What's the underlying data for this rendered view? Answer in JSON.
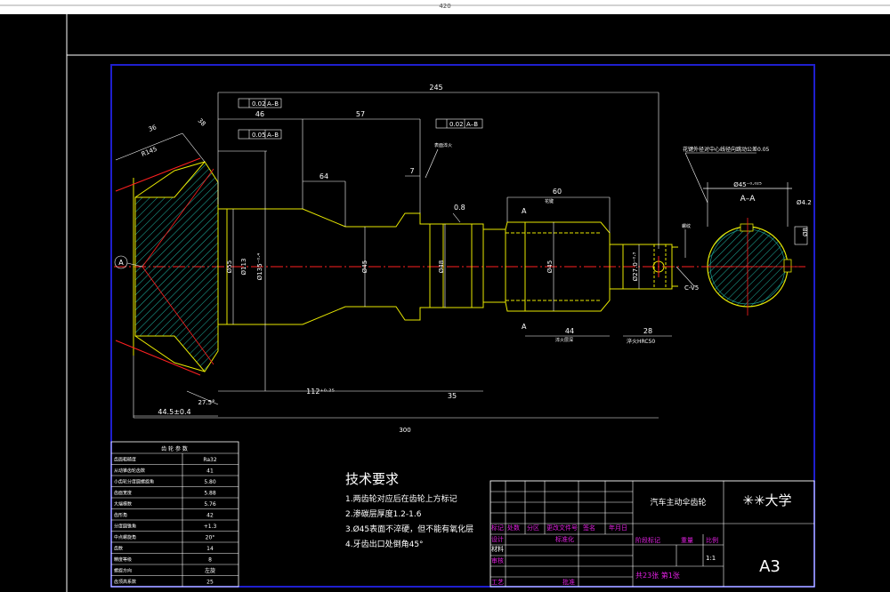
{
  "sheet": {
    "overall_width_label": "420",
    "format_label": "A3",
    "university_label": "✳✳大学",
    "part_name": "汽车主动伞齿轮",
    "scale_value": "1:1",
    "sheet_count": "共23张 第1张"
  },
  "dimensions": {
    "d245": "245",
    "d46": "46",
    "d57": "57",
    "d64": "64",
    "d7": "7",
    "d60": "60",
    "d44": "44",
    "d28": "28",
    "d35": "35",
    "d300": "300",
    "d112": "112⁺⁰·²⁵",
    "d44_5": "44.5±0.4",
    "d27_5": "27.5°",
    "d38": "38",
    "d36": "36",
    "r145": "R145",
    "phi45_shaft": "Ø45",
    "phi48": "Ø48",
    "phi45_spline": "Ø45",
    "phi27": "Ø27.0⁻⁰·³",
    "phi113": "Ø113",
    "phi135": "Ø135⁻⁰·⁴",
    "phi55": "Ø55",
    "phi45_section": "Ø45⁻⁰·⁰²⁵",
    "phi42": "Ø4.2",
    "phi8": "Ø8",
    "rough_08": "0.8",
    "c_v5": "C-V5",
    "hrc": "淬火HRC50",
    "section_label": "A–A",
    "datum_a": "A",
    "tol1": "0.02",
    "tol1_ref": "A–B",
    "tol2": "0.05",
    "tol2_ref": "A–B",
    "tol3": "0.02",
    "tol3_ref": "A–B",
    "tol4": "0.05",
    "note_spline": "花键外径对中心线径向跳动公差0.05",
    "note_small1": "表面淬火",
    "note_small2": "花键",
    "note_small3": "淬火层深",
    "note_small4": "渗碳淬火",
    "note_small5": "螺纹",
    "cut_a1": "A",
    "cut_a2": "A"
  },
  "gear_params": {
    "title": "齿 轮 参 数",
    "rows": [
      {
        "name": "齿面粗糙度",
        "value": "Ra32"
      },
      {
        "name": "从动锥齿轮齿数",
        "value": "41"
      },
      {
        "name": "小齿轮分度圆螺旋角",
        "value": "5.80"
      },
      {
        "name": "齿面宽度",
        "value": "5.88"
      },
      {
        "name": "大端模数",
        "value": "5.76"
      },
      {
        "name": "齿形角",
        "value": "42"
      },
      {
        "name": "分度圆锥角",
        "value": "+1.3"
      },
      {
        "name": "中点螺旋角",
        "value": "20°"
      },
      {
        "name": "齿数",
        "value": "14"
      },
      {
        "name": "精度等级",
        "value": "8"
      },
      {
        "name": "螺旋方向",
        "value": "左旋"
      },
      {
        "name": "齿顶高系数",
        "value": "25"
      }
    ]
  },
  "tech_requirements": {
    "title": "技术要求",
    "items": [
      "1.两齿轮对应后在齿轮上方标记",
      "2.渗碳层厚度1.2-1.6",
      "3.Ø45表面不淬硬，但不能有氧化层",
      "4.牙齿出口处倒角45°"
    ]
  },
  "title_block": {
    "row_labels": [
      "标记",
      "处数",
      "分区",
      "更改文件号",
      "签名",
      "年月日"
    ],
    "design": "设计",
    "standard": "标准化",
    "material": "材料",
    "review": "审核",
    "process": "工艺",
    "approve": "批准",
    "stage_mark": "阶段标记",
    "weight": "重量",
    "scale": "比例"
  },
  "colors": {
    "background": "#000000",
    "frame": "#1f1fcf",
    "outline": "#e8e800",
    "dimension": "#ffffff",
    "hatch": "#1fb0a0",
    "center": "#ff2020",
    "magenta": "#e020e0"
  }
}
